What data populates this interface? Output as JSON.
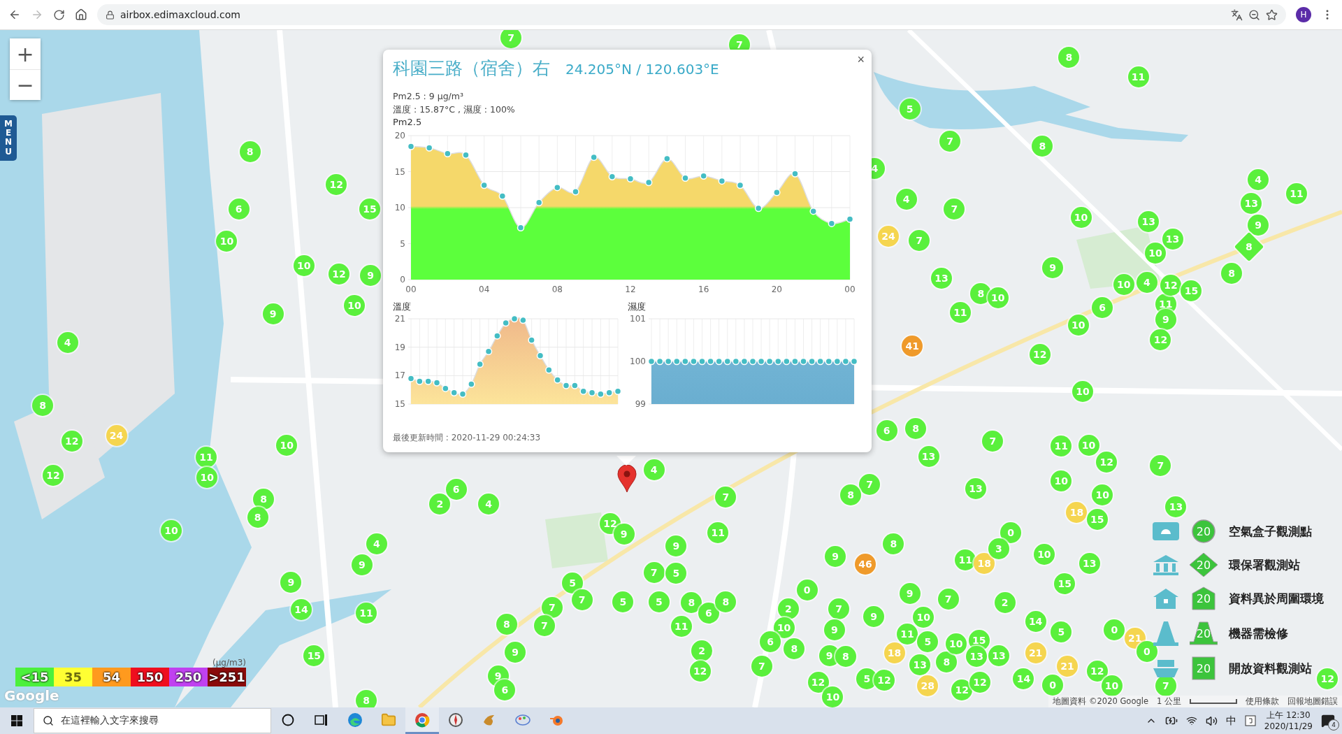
{
  "browser": {
    "url": "airbox.edimaxcloud.com",
    "profile": "H"
  },
  "map": {
    "zoom_in": "+",
    "zoom_out": "−",
    "menu": "MENU",
    "markers": [
      {
        "value": "7",
        "color": "#5af03c",
        "kind": "circle"
      },
      {
        "value": "7",
        "color": "#5af03c",
        "kind": "circle"
      },
      {
        "value": "8",
        "color": "#5af03c",
        "kind": "circle"
      },
      {
        "value": "11",
        "color": "#5af03c",
        "kind": "circle"
      },
      {
        "value": "5",
        "color": "#5af03c",
        "kind": "circle"
      },
      {
        "value": "8",
        "color": "#5af03c",
        "kind": "circle"
      },
      {
        "value": "7",
        "color": "#5af03c",
        "kind": "circle"
      },
      {
        "value": "8",
        "color": "#5af03c",
        "kind": "circle"
      },
      {
        "value": "4",
        "color": "#5af03c",
        "kind": "circle"
      },
      {
        "value": "12",
        "color": "#5af03c",
        "kind": "circle"
      },
      {
        "value": "4",
        "color": "#5af03c",
        "kind": "circle"
      },
      {
        "value": "4",
        "color": "#5af03c",
        "kind": "circle"
      },
      {
        "value": "11",
        "color": "#5af03c",
        "kind": "circle"
      },
      {
        "value": "6",
        "color": "#5af03c",
        "kind": "circle"
      },
      {
        "value": "15",
        "color": "#5af03c",
        "kind": "circle"
      },
      {
        "value": "7",
        "color": "#5af03c",
        "kind": "circle"
      },
      {
        "value": "10",
        "color": "#5af03c",
        "kind": "circle"
      },
      {
        "value": "13",
        "color": "#5af03c",
        "kind": "circle"
      },
      {
        "value": "13",
        "color": "#5af03c",
        "kind": "circle"
      },
      {
        "value": "9",
        "color": "#5af03c",
        "kind": "circle"
      },
      {
        "value": "10",
        "color": "#5af03c",
        "kind": "circle"
      },
      {
        "value": "24",
        "color": "#f5d54f",
        "kind": "circle"
      },
      {
        "value": "7",
        "color": "#5af03c",
        "kind": "circle"
      },
      {
        "value": "10",
        "color": "#5af03c",
        "kind": "circle"
      },
      {
        "value": "13",
        "color": "#5af03c",
        "kind": "circle"
      },
      {
        "value": "8",
        "color": "#5af03c",
        "kind": "diamond"
      },
      {
        "value": "10",
        "color": "#5af03c",
        "kind": "circle"
      },
      {
        "value": "12",
        "color": "#5af03c",
        "kind": "circle"
      },
      {
        "value": "9",
        "color": "#5af03c",
        "kind": "circle"
      },
      {
        "value": "13",
        "color": "#5af03c",
        "kind": "circle"
      },
      {
        "value": "9",
        "color": "#5af03c",
        "kind": "circle"
      },
      {
        "value": "8",
        "color": "#5af03c",
        "kind": "circle"
      },
      {
        "value": "10",
        "color": "#5af03c",
        "kind": "circle"
      },
      {
        "value": "8",
        "color": "#5af03c",
        "kind": "circle"
      },
      {
        "value": "10",
        "color": "#5af03c",
        "kind": "circle"
      },
      {
        "value": "6",
        "color": "#5af03c",
        "kind": "circle"
      },
      {
        "value": "10",
        "color": "#5af03c",
        "kind": "circle"
      },
      {
        "value": "4",
        "color": "#5af03c",
        "kind": "circle"
      },
      {
        "value": "11",
        "color": "#5af03c",
        "kind": "circle"
      },
      {
        "value": "12",
        "color": "#5af03c",
        "kind": "circle"
      },
      {
        "value": "15",
        "color": "#5af03c",
        "kind": "circle"
      },
      {
        "value": "9",
        "color": "#5af03c",
        "kind": "circle"
      },
      {
        "value": "11",
        "color": "#5af03c",
        "kind": "circle"
      },
      {
        "value": "10",
        "color": "#5af03c",
        "kind": "circle"
      },
      {
        "value": "9",
        "color": "#5af03c",
        "kind": "circle"
      },
      {
        "value": "4",
        "color": "#5af03c",
        "kind": "circle"
      },
      {
        "value": "41",
        "color": "#ef9a2b",
        "kind": "circle"
      },
      {
        "value": "12",
        "color": "#5af03c",
        "kind": "circle"
      },
      {
        "value": "12",
        "color": "#5af03c",
        "kind": "circle"
      },
      {
        "value": "8",
        "color": "#5af03c",
        "kind": "circle"
      },
      {
        "value": "10",
        "color": "#5af03c",
        "kind": "circle"
      },
      {
        "value": "24",
        "color": "#f5d54f",
        "kind": "circle"
      },
      {
        "value": "6",
        "color": "#5af03c",
        "kind": "circle"
      },
      {
        "value": "8",
        "color": "#5af03c",
        "kind": "circle"
      },
      {
        "value": "12",
        "color": "#5af03c",
        "kind": "circle"
      },
      {
        "value": "11",
        "color": "#5af03c",
        "kind": "circle"
      },
      {
        "value": "10",
        "color": "#5af03c",
        "kind": "circle"
      },
      {
        "value": "13",
        "color": "#5af03c",
        "kind": "circle"
      },
      {
        "value": "7",
        "color": "#5af03c",
        "kind": "circle"
      },
      {
        "value": "11",
        "color": "#5af03c",
        "kind": "circle"
      },
      {
        "value": "10",
        "color": "#5af03c",
        "kind": "circle"
      },
      {
        "value": "12",
        "color": "#5af03c",
        "kind": "circle"
      },
      {
        "value": "10",
        "color": "#5af03c",
        "kind": "circle"
      },
      {
        "value": "4",
        "color": "#5af03c",
        "kind": "circle"
      },
      {
        "value": "7",
        "color": "#5af03c",
        "kind": "circle"
      },
      {
        "value": "10",
        "color": "#5af03c",
        "kind": "circle"
      },
      {
        "value": "12",
        "color": "#5af03c",
        "kind": "circle"
      },
      {
        "value": "7",
        "color": "#5af03c",
        "kind": "circle"
      },
      {
        "value": "8",
        "color": "#5af03c",
        "kind": "circle"
      },
      {
        "value": "2",
        "color": "#5af03c",
        "kind": "circle"
      },
      {
        "value": "6",
        "color": "#5af03c",
        "kind": "circle"
      },
      {
        "value": "4",
        "color": "#5af03c",
        "kind": "circle"
      },
      {
        "value": "7",
        "color": "#5af03c",
        "kind": "circle"
      },
      {
        "value": "8",
        "color": "#5af03c",
        "kind": "circle"
      },
      {
        "value": "13",
        "color": "#5af03c",
        "kind": "circle"
      },
      {
        "value": "18",
        "color": "#f5d54f",
        "kind": "circle"
      },
      {
        "value": "10",
        "color": "#5af03c",
        "kind": "circle"
      },
      {
        "value": "13",
        "color": "#5af03c",
        "kind": "circle"
      },
      {
        "value": "10",
        "color": "#5af03c",
        "kind": "circle"
      },
      {
        "value": "8",
        "color": "#5af03c",
        "kind": "circle"
      },
      {
        "value": "12",
        "color": "#5af03c",
        "kind": "circle"
      },
      {
        "value": "9",
        "color": "#5af03c",
        "kind": "circle"
      },
      {
        "value": "11",
        "color": "#5af03c",
        "kind": "circle"
      },
      {
        "value": "0",
        "color": "#5af03c",
        "kind": "circle"
      },
      {
        "value": "15",
        "color": "#5af03c",
        "kind": "circle"
      },
      {
        "value": "4",
        "color": "#5af03c",
        "kind": "circle"
      },
      {
        "value": "9",
        "color": "#5af03c",
        "kind": "circle"
      },
      {
        "value": "9",
        "color": "#5af03c",
        "kind": "circle"
      },
      {
        "value": "46",
        "color": "#ef9a2b",
        "kind": "circle"
      },
      {
        "value": "8",
        "color": "#5af03c",
        "kind": "circle"
      },
      {
        "value": "11",
        "color": "#5af03c",
        "kind": "circle"
      },
      {
        "value": "18",
        "color": "#f5d54f",
        "kind": "circle"
      },
      {
        "value": "3",
        "color": "#5af03c",
        "kind": "circle"
      },
      {
        "value": "10",
        "color": "#5af03c",
        "kind": "circle"
      },
      {
        "value": "13",
        "color": "#5af03c",
        "kind": "circle"
      },
      {
        "value": "9",
        "color": "#5af03c",
        "kind": "circle"
      },
      {
        "value": "9",
        "color": "#5af03c",
        "kind": "circle"
      },
      {
        "value": "5",
        "color": "#5af03c",
        "kind": "circle"
      },
      {
        "value": "7",
        "color": "#5af03c",
        "kind": "circle"
      },
      {
        "value": "5",
        "color": "#5af03c",
        "kind": "circle"
      },
      {
        "value": "0",
        "color": "#5af03c",
        "kind": "circle"
      },
      {
        "value": "15",
        "color": "#5af03c",
        "kind": "circle"
      },
      {
        "value": "14",
        "color": "#5af03c",
        "kind": "circle"
      },
      {
        "value": "11",
        "color": "#5af03c",
        "kind": "circle"
      },
      {
        "value": "7",
        "color": "#5af03c",
        "kind": "circle"
      },
      {
        "value": "7",
        "color": "#5af03c",
        "kind": "circle"
      },
      {
        "value": "5",
        "color": "#5af03c",
        "kind": "circle"
      },
      {
        "value": "5",
        "color": "#5af03c",
        "kind": "circle"
      },
      {
        "value": "8",
        "color": "#5af03c",
        "kind": "circle"
      },
      {
        "value": "6",
        "color": "#5af03c",
        "kind": "circle"
      },
      {
        "value": "8",
        "color": "#5af03c",
        "kind": "circle"
      },
      {
        "value": "2",
        "color": "#5af03c",
        "kind": "circle"
      },
      {
        "value": "7",
        "color": "#5af03c",
        "kind": "circle"
      },
      {
        "value": "9",
        "color": "#5af03c",
        "kind": "circle"
      },
      {
        "value": "7",
        "color": "#5af03c",
        "kind": "circle"
      },
      {
        "value": "2",
        "color": "#5af03c",
        "kind": "circle"
      },
      {
        "value": "8",
        "color": "#5af03c",
        "kind": "circle"
      },
      {
        "value": "7",
        "color": "#5af03c",
        "kind": "circle"
      },
      {
        "value": "11",
        "color": "#5af03c",
        "kind": "circle"
      },
      {
        "value": "10",
        "color": "#5af03c",
        "kind": "circle"
      },
      {
        "value": "9",
        "color": "#5af03c",
        "kind": "circle"
      },
      {
        "value": "9",
        "color": "#5af03c",
        "kind": "circle"
      },
      {
        "value": "11",
        "color": "#5af03c",
        "kind": "circle"
      },
      {
        "value": "10",
        "color": "#5af03c",
        "kind": "circle"
      },
      {
        "value": "15",
        "color": "#5af03c",
        "kind": "circle"
      },
      {
        "value": "14",
        "color": "#5af03c",
        "kind": "circle"
      },
      {
        "value": "5",
        "color": "#5af03c",
        "kind": "circle"
      },
      {
        "value": "0",
        "color": "#5af03c",
        "kind": "circle"
      },
      {
        "value": "21",
        "color": "#f5d54f",
        "kind": "circle"
      },
      {
        "value": "15",
        "color": "#5af03c",
        "kind": "circle"
      },
      {
        "value": "9",
        "color": "#5af03c",
        "kind": "circle"
      },
      {
        "value": "2",
        "color": "#5af03c",
        "kind": "circle"
      },
      {
        "value": "7",
        "color": "#5af03c",
        "kind": "circle"
      },
      {
        "value": "6",
        "color": "#5af03c",
        "kind": "circle"
      },
      {
        "value": "8",
        "color": "#5af03c",
        "kind": "circle"
      },
      {
        "value": "9",
        "color": "#5af03c",
        "kind": "circle"
      },
      {
        "value": "8",
        "color": "#5af03c",
        "kind": "circle"
      },
      {
        "value": "18",
        "color": "#f5d54f",
        "kind": "circle"
      },
      {
        "value": "13",
        "color": "#5af03c",
        "kind": "circle"
      },
      {
        "value": "5",
        "color": "#5af03c",
        "kind": "circle"
      },
      {
        "value": "8",
        "color": "#5af03c",
        "kind": "circle"
      },
      {
        "value": "10",
        "color": "#5af03c",
        "kind": "circle"
      },
      {
        "value": "13",
        "color": "#5af03c",
        "kind": "circle"
      },
      {
        "value": "13",
        "color": "#5af03c",
        "kind": "circle"
      },
      {
        "value": "21",
        "color": "#f5d54f",
        "kind": "circle"
      },
      {
        "value": "21",
        "color": "#f5d54f",
        "kind": "circle"
      },
      {
        "value": "0",
        "color": "#5af03c",
        "kind": "circle"
      },
      {
        "value": "9",
        "color": "#5af03c",
        "kind": "circle"
      },
      {
        "value": "6",
        "color": "#5af03c",
        "kind": "circle"
      },
      {
        "value": "12",
        "color": "#5af03c",
        "kind": "circle"
      },
      {
        "value": "12",
        "color": "#5af03c",
        "kind": "circle"
      },
      {
        "value": "5",
        "color": "#5af03c",
        "kind": "circle"
      },
      {
        "value": "12",
        "color": "#5af03c",
        "kind": "circle"
      },
      {
        "value": "28",
        "color": "#f5d54f",
        "kind": "circle"
      },
      {
        "value": "12",
        "color": "#5af03c",
        "kind": "circle"
      },
      {
        "value": "12",
        "color": "#5af03c",
        "kind": "circle"
      },
      {
        "value": "14",
        "color": "#5af03c",
        "kind": "circle"
      },
      {
        "value": "0",
        "color": "#5af03c",
        "kind": "circle"
      },
      {
        "value": "12",
        "color": "#5af03c",
        "kind": "circle"
      },
      {
        "value": "10",
        "color": "#5af03c",
        "kind": "circle"
      },
      {
        "value": "7",
        "color": "#5af03c",
        "kind": "circle"
      },
      {
        "value": "12",
        "color": "#5af03c",
        "kind": "circle"
      },
      {
        "value": "8",
        "color": "#5af03c",
        "kind": "circle"
      },
      {
        "value": "10",
        "color": "#5af03c",
        "kind": "circle"
      }
    ],
    "popup": {
      "title": "科園三路（宿舍）右",
      "coords": "24.205°N / 120.603°E",
      "close": "×",
      "pm25": "Pm2.5 : 9 μg/m³",
      "weather": "溫度 : 15.87°C , 濕度 : 100%",
      "pm_chart": {
        "chart_data": {
          "type": "area",
          "title": "Pm2.5",
          "grid": true,
          "x": [
            0,
            1,
            2,
            3,
            4,
            5,
            6,
            7,
            8,
            9,
            10,
            11,
            12,
            13,
            14,
            15,
            16,
            17,
            18,
            19,
            20,
            21,
            22,
            23,
            24
          ],
          "xlim": [
            0,
            24
          ],
          "ylim": [
            0,
            20
          ],
          "yticks": [
            {
              "value": 0,
              "label": "0"
            },
            {
              "value": 5,
              "label": "5"
            },
            {
              "value": 10,
              "label": "10"
            },
            {
              "value": 15,
              "label": "15"
            },
            {
              "value": 20,
              "label": "20"
            }
          ],
          "xticks": [
            {
              "value": 0,
              "label": "00"
            },
            {
              "value": 4,
              "label": "04"
            },
            {
              "value": 8,
              "label": "08"
            },
            {
              "value": 12,
              "label": "12"
            },
            {
              "value": 16,
              "label": "16"
            },
            {
              "value": 20,
              "label": "20"
            },
            {
              "value": 24,
              "label": "00"
            }
          ],
          "series": [
            {
              "color": "#f5d86a",
              "values": [
                18.5,
                18.3,
                17.5,
                17.3,
                13.1,
                11.6,
                7.2,
                10.7,
                12.8,
                12.2,
                17.0,
                14.3,
                14.0,
                13.5,
                16.8,
                14.1,
                14.4,
                13.7,
                13.1,
                9.9,
                12.1,
                14.7,
                9.5,
                7.8,
                8.4
              ]
            }
          ]
        }
      },
      "temp_chart": {
        "chart_data": {
          "type": "area",
          "title": "溫度",
          "grid": true,
          "ylim": [
            15,
            21
          ],
          "yticks": [
            15,
            17,
            19,
            21
          ],
          "series": [
            {
              "color": "#f0b98a",
              "values": [
                16.8,
                16.6,
                16.6,
                16.5,
                16.1,
                15.8,
                15.7,
                16.4,
                17.8,
                18.7,
                19.8,
                20.7,
                21.0,
                20.9,
                19.5,
                18.4,
                17.4,
                16.7,
                16.3,
                16.3,
                15.9,
                15.8,
                15.7,
                15.8,
                15.9
              ]
            }
          ]
        }
      },
      "humidity_chart": {
        "chart_data": {
          "type": "area",
          "title": "濕度",
          "grid": true,
          "ylim": [
            99,
            101
          ],
          "yticks": [
            99,
            100,
            101
          ],
          "series": [
            {
              "color": "#78b9d8",
              "values": [
                100,
                100,
                100,
                100,
                100,
                100,
                100,
                100,
                100,
                100,
                100,
                100,
                100,
                100,
                100,
                100,
                100,
                100,
                100,
                100,
                100,
                100,
                100,
                100,
                100
              ]
            }
          ]
        }
      },
      "updated": "最後更新時間 : 2020-11-29 00:24:33"
    },
    "scale": {
      "unit": "(μg/m3)",
      "levels": [
        {
          "label": "<15",
          "color": "#4cf03c"
        },
        {
          "label": "35",
          "color": "#ffff33"
        },
        {
          "label": "54",
          "color": "#ff9a1e"
        },
        {
          "label": "150",
          "color": "#ef0e1e"
        },
        {
          "label": "250",
          "color": "#c041f0"
        },
        {
          "label": ">251",
          "color": "#8a0b0b"
        }
      ]
    },
    "legend": [
      {
        "kind": "airbox",
        "marker": "20",
        "label": "空氣盒子觀測點"
      },
      {
        "kind": "epa",
        "marker": "20",
        "label": "環保署觀測站"
      },
      {
        "kind": "anomaly",
        "marker": "20",
        "label": "資料異於周圍環境"
      },
      {
        "kind": "repair",
        "marker": "20",
        "label": "機器需檢修"
      },
      {
        "kind": "open",
        "marker": "20",
        "label": "開放資料觀測站"
      }
    ],
    "attribution": {
      "logo": "Google",
      "data": "地圖資料 ©2020 Google",
      "scale": "1 公里",
      "terms": "使用條款",
      "report": "回報地圖錯誤"
    }
  },
  "taskbar": {
    "search_placeholder": "在這裡輸入文字來搜尋",
    "apps": [
      {
        "kind": "cortana",
        "selected": false
      },
      {
        "kind": "taskview",
        "selected": false
      },
      {
        "kind": "edge",
        "selected": false
      },
      {
        "kind": "explorer",
        "selected": false
      },
      {
        "kind": "chrome",
        "selected": true
      },
      {
        "kind": "compass",
        "selected": false
      },
      {
        "kind": "bird",
        "selected": false
      },
      {
        "kind": "paint",
        "selected": false
      },
      {
        "kind": "blender",
        "selected": false
      }
    ],
    "ime": "中",
    "time": "上午 12:30",
    "date": "2020/11/29",
    "notifications": "4"
  }
}
